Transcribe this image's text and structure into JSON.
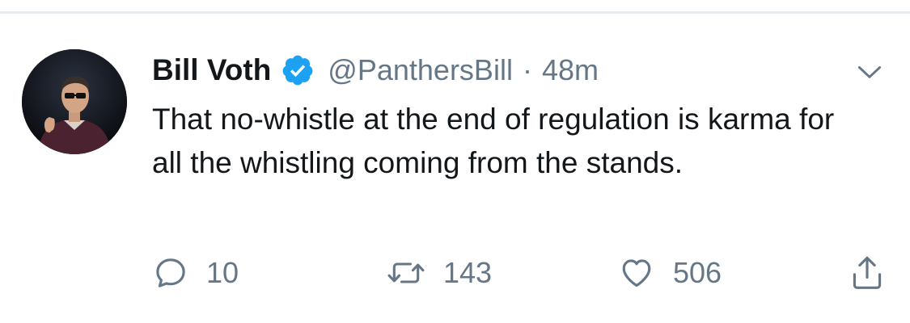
{
  "tweet": {
    "author_name": "Bill Voth",
    "handle": "@PanthersBill",
    "separator": "·",
    "timestamp": "48m",
    "verified": true,
    "text": "That no-whistle at the end of regulation is karma for all the whistling coming from the stands.",
    "avatar_icon": "profile-photo",
    "menu_icon": "chevron-down-icon"
  },
  "actions": {
    "reply_count": "10",
    "retweet_count": "143",
    "like_count": "506",
    "reply_icon": "reply-icon",
    "retweet_icon": "retweet-icon",
    "like_icon": "heart-icon",
    "share_icon": "share-icon"
  },
  "colors": {
    "text": "#14171a",
    "secondary": "#657786",
    "verified_blue": "#1da1f2",
    "divider": "#e6ecf0"
  }
}
